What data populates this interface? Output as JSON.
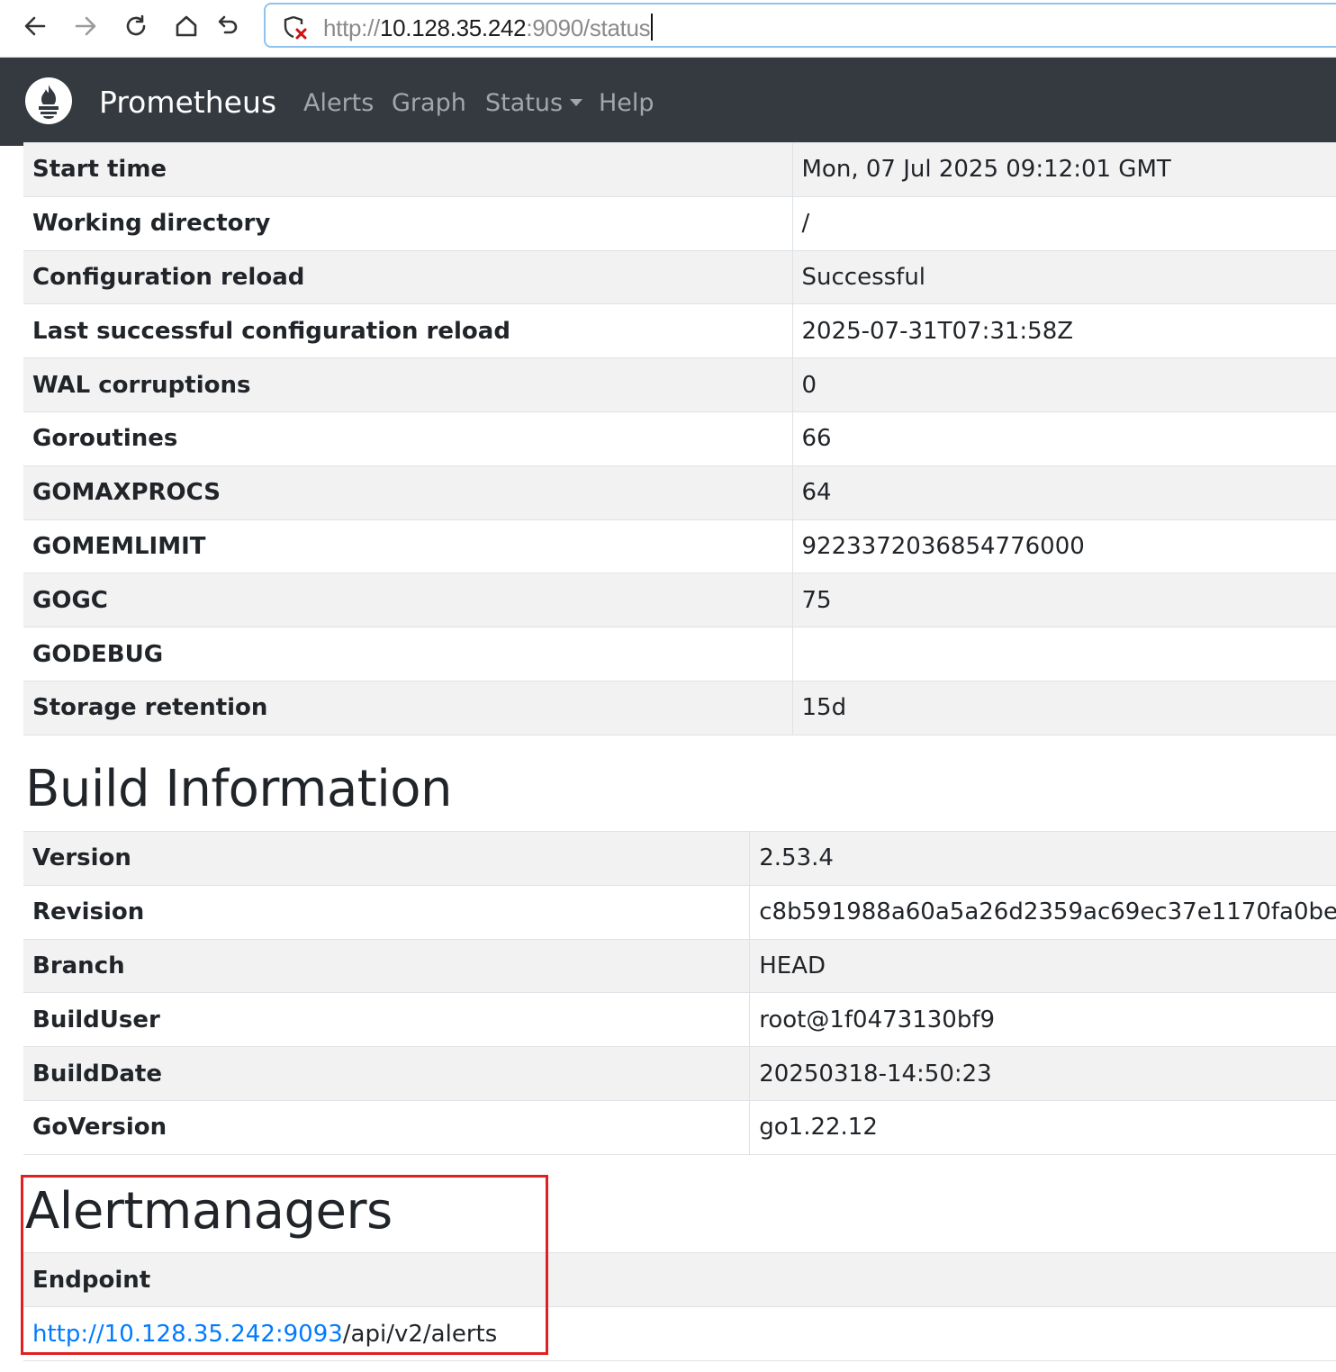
{
  "browser": {
    "url_scheme": "http://",
    "url_host": "10.128.35.242",
    "url_rest": ":9090/status"
  },
  "navbar": {
    "brand": "Prometheus",
    "links": [
      {
        "label": "Alerts"
      },
      {
        "label": "Graph"
      },
      {
        "label": "Status"
      },
      {
        "label": "Help"
      }
    ]
  },
  "runtime": {
    "rows": [
      {
        "key": "Start time",
        "value": "Mon, 07 Jul 2025 09:12:01 GMT"
      },
      {
        "key": "Working directory",
        "value": "/"
      },
      {
        "key": "Configuration reload",
        "value": "Successful"
      },
      {
        "key": "Last successful configuration reload",
        "value": "2025-07-31T07:31:58Z"
      },
      {
        "key": "WAL corruptions",
        "value": "0"
      },
      {
        "key": "Goroutines",
        "value": "66"
      },
      {
        "key": "GOMAXPROCS",
        "value": "64"
      },
      {
        "key": "GOMEMLIMIT",
        "value": "9223372036854776000"
      },
      {
        "key": "GOGC",
        "value": "75"
      },
      {
        "key": "GODEBUG",
        "value": ""
      },
      {
        "key": "Storage retention",
        "value": "15d"
      }
    ]
  },
  "build": {
    "title": "Build Information",
    "rows": [
      {
        "key": "Version",
        "value": "2.53.4"
      },
      {
        "key": "Revision",
        "value": "c8b591988a60a5a26d2359ac69ec37e1170fa0be"
      },
      {
        "key": "Branch",
        "value": "HEAD"
      },
      {
        "key": "BuildUser",
        "value": "root@1f0473130bf9"
      },
      {
        "key": "BuildDate",
        "value": "20250318-14:50:23"
      },
      {
        "key": "GoVersion",
        "value": "go1.22.12"
      }
    ]
  },
  "alertmanagers": {
    "title": "Alertmanagers",
    "header": "Endpoint",
    "endpoint_link": "http://10.128.35.242:9093",
    "endpoint_path": "/api/v2/alerts"
  }
}
